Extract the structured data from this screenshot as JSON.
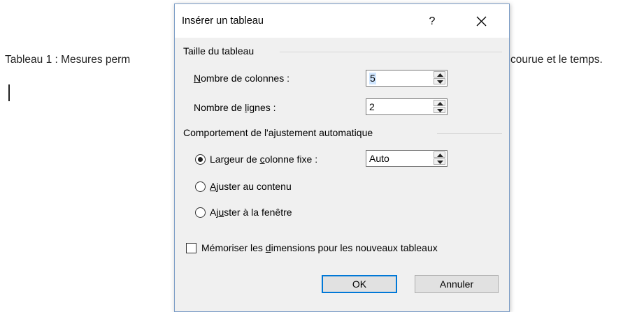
{
  "document": {
    "caption_left": "Tableau 1 : Mesures perm",
    "caption_right": "courue et le temps."
  },
  "dialog": {
    "title": "Insérer un tableau",
    "help_label": "?",
    "size_section": "Taille du tableau",
    "columns": {
      "label_pre": "",
      "label_accel": "N",
      "label_post": "ombre de colonnes :",
      "value": "5"
    },
    "rows": {
      "label_pre": "Nombre de ",
      "label_accel": "l",
      "label_post": "ignes :",
      "value": "2"
    },
    "autofit_section": "Comportement de l'ajustement automatique",
    "fixed_width": {
      "label_pre": "Largeur de ",
      "label_accel": "c",
      "label_post": "olonne fixe :",
      "value": "Auto",
      "checked": true
    },
    "fit_contents": {
      "label_pre": "",
      "label_accel": "A",
      "label_post": "juster au contenu",
      "checked": false
    },
    "fit_window": {
      "label_pre": "Aj",
      "label_accel": "u",
      "label_post": "ster à la fenêtre",
      "checked": false
    },
    "remember": {
      "label_pre": "Mémoriser les ",
      "label_accel": "d",
      "label_post": "imensions pour les nouveaux tableaux",
      "checked": false
    },
    "ok_label": "OK",
    "cancel_label": "Annuler"
  }
}
